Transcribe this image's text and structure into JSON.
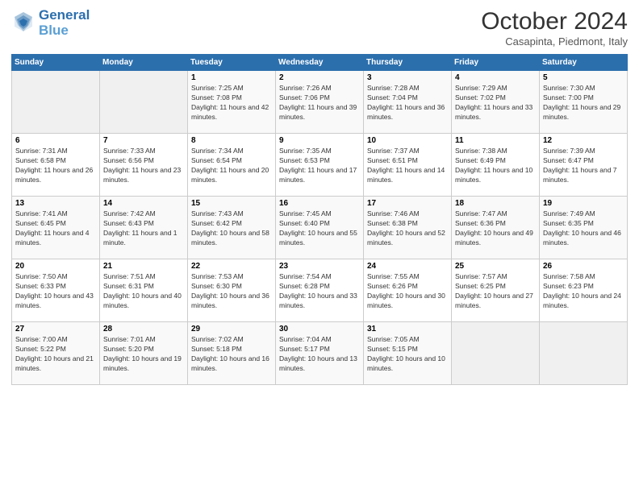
{
  "header": {
    "logo_line1": "General",
    "logo_line2": "Blue",
    "month": "October 2024",
    "location": "Casapinta, Piedmont, Italy"
  },
  "weekdays": [
    "Sunday",
    "Monday",
    "Tuesday",
    "Wednesday",
    "Thursday",
    "Friday",
    "Saturday"
  ],
  "weeks": [
    [
      {
        "day": "",
        "sunrise": "",
        "sunset": "",
        "daylight": "",
        "empty": true
      },
      {
        "day": "",
        "sunrise": "",
        "sunset": "",
        "daylight": "",
        "empty": true
      },
      {
        "day": "1",
        "sunrise": "Sunrise: 7:25 AM",
        "sunset": "Sunset: 7:08 PM",
        "daylight": "Daylight: 11 hours and 42 minutes."
      },
      {
        "day": "2",
        "sunrise": "Sunrise: 7:26 AM",
        "sunset": "Sunset: 7:06 PM",
        "daylight": "Daylight: 11 hours and 39 minutes."
      },
      {
        "day": "3",
        "sunrise": "Sunrise: 7:28 AM",
        "sunset": "Sunset: 7:04 PM",
        "daylight": "Daylight: 11 hours and 36 minutes."
      },
      {
        "day": "4",
        "sunrise": "Sunrise: 7:29 AM",
        "sunset": "Sunset: 7:02 PM",
        "daylight": "Daylight: 11 hours and 33 minutes."
      },
      {
        "day": "5",
        "sunrise": "Sunrise: 7:30 AM",
        "sunset": "Sunset: 7:00 PM",
        "daylight": "Daylight: 11 hours and 29 minutes."
      }
    ],
    [
      {
        "day": "6",
        "sunrise": "Sunrise: 7:31 AM",
        "sunset": "Sunset: 6:58 PM",
        "daylight": "Daylight: 11 hours and 26 minutes."
      },
      {
        "day": "7",
        "sunrise": "Sunrise: 7:33 AM",
        "sunset": "Sunset: 6:56 PM",
        "daylight": "Daylight: 11 hours and 23 minutes."
      },
      {
        "day": "8",
        "sunrise": "Sunrise: 7:34 AM",
        "sunset": "Sunset: 6:54 PM",
        "daylight": "Daylight: 11 hours and 20 minutes."
      },
      {
        "day": "9",
        "sunrise": "Sunrise: 7:35 AM",
        "sunset": "Sunset: 6:53 PM",
        "daylight": "Daylight: 11 hours and 17 minutes."
      },
      {
        "day": "10",
        "sunrise": "Sunrise: 7:37 AM",
        "sunset": "Sunset: 6:51 PM",
        "daylight": "Daylight: 11 hours and 14 minutes."
      },
      {
        "day": "11",
        "sunrise": "Sunrise: 7:38 AM",
        "sunset": "Sunset: 6:49 PM",
        "daylight": "Daylight: 11 hours and 10 minutes."
      },
      {
        "day": "12",
        "sunrise": "Sunrise: 7:39 AM",
        "sunset": "Sunset: 6:47 PM",
        "daylight": "Daylight: 11 hours and 7 minutes."
      }
    ],
    [
      {
        "day": "13",
        "sunrise": "Sunrise: 7:41 AM",
        "sunset": "Sunset: 6:45 PM",
        "daylight": "Daylight: 11 hours and 4 minutes."
      },
      {
        "day": "14",
        "sunrise": "Sunrise: 7:42 AM",
        "sunset": "Sunset: 6:43 PM",
        "daylight": "Daylight: 11 hours and 1 minute."
      },
      {
        "day": "15",
        "sunrise": "Sunrise: 7:43 AM",
        "sunset": "Sunset: 6:42 PM",
        "daylight": "Daylight: 10 hours and 58 minutes."
      },
      {
        "day": "16",
        "sunrise": "Sunrise: 7:45 AM",
        "sunset": "Sunset: 6:40 PM",
        "daylight": "Daylight: 10 hours and 55 minutes."
      },
      {
        "day": "17",
        "sunrise": "Sunrise: 7:46 AM",
        "sunset": "Sunset: 6:38 PM",
        "daylight": "Daylight: 10 hours and 52 minutes."
      },
      {
        "day": "18",
        "sunrise": "Sunrise: 7:47 AM",
        "sunset": "Sunset: 6:36 PM",
        "daylight": "Daylight: 10 hours and 49 minutes."
      },
      {
        "day": "19",
        "sunrise": "Sunrise: 7:49 AM",
        "sunset": "Sunset: 6:35 PM",
        "daylight": "Daylight: 10 hours and 46 minutes."
      }
    ],
    [
      {
        "day": "20",
        "sunrise": "Sunrise: 7:50 AM",
        "sunset": "Sunset: 6:33 PM",
        "daylight": "Daylight: 10 hours and 43 minutes."
      },
      {
        "day": "21",
        "sunrise": "Sunrise: 7:51 AM",
        "sunset": "Sunset: 6:31 PM",
        "daylight": "Daylight: 10 hours and 40 minutes."
      },
      {
        "day": "22",
        "sunrise": "Sunrise: 7:53 AM",
        "sunset": "Sunset: 6:30 PM",
        "daylight": "Daylight: 10 hours and 36 minutes."
      },
      {
        "day": "23",
        "sunrise": "Sunrise: 7:54 AM",
        "sunset": "Sunset: 6:28 PM",
        "daylight": "Daylight: 10 hours and 33 minutes."
      },
      {
        "day": "24",
        "sunrise": "Sunrise: 7:55 AM",
        "sunset": "Sunset: 6:26 PM",
        "daylight": "Daylight: 10 hours and 30 minutes."
      },
      {
        "day": "25",
        "sunrise": "Sunrise: 7:57 AM",
        "sunset": "Sunset: 6:25 PM",
        "daylight": "Daylight: 10 hours and 27 minutes."
      },
      {
        "day": "26",
        "sunrise": "Sunrise: 7:58 AM",
        "sunset": "Sunset: 6:23 PM",
        "daylight": "Daylight: 10 hours and 24 minutes."
      }
    ],
    [
      {
        "day": "27",
        "sunrise": "Sunrise: 7:00 AM",
        "sunset": "Sunset: 5:22 PM",
        "daylight": "Daylight: 10 hours and 21 minutes."
      },
      {
        "day": "28",
        "sunrise": "Sunrise: 7:01 AM",
        "sunset": "Sunset: 5:20 PM",
        "daylight": "Daylight: 10 hours and 19 minutes."
      },
      {
        "day": "29",
        "sunrise": "Sunrise: 7:02 AM",
        "sunset": "Sunset: 5:18 PM",
        "daylight": "Daylight: 10 hours and 16 minutes."
      },
      {
        "day": "30",
        "sunrise": "Sunrise: 7:04 AM",
        "sunset": "Sunset: 5:17 PM",
        "daylight": "Daylight: 10 hours and 13 minutes."
      },
      {
        "day": "31",
        "sunrise": "Sunrise: 7:05 AM",
        "sunset": "Sunset: 5:15 PM",
        "daylight": "Daylight: 10 hours and 10 minutes."
      },
      {
        "day": "",
        "sunrise": "",
        "sunset": "",
        "daylight": "",
        "empty": true
      },
      {
        "day": "",
        "sunrise": "",
        "sunset": "",
        "daylight": "",
        "empty": true
      }
    ]
  ]
}
